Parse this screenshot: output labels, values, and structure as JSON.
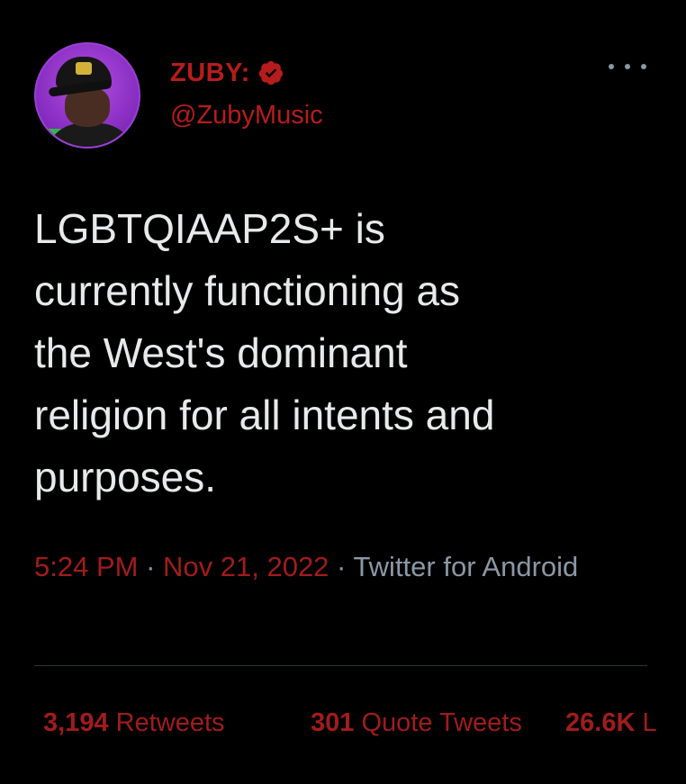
{
  "author": {
    "display_name": "ZUBY:",
    "handle": "@ZubyMusic",
    "verified": true
  },
  "tweet": {
    "text": "LGBTQIAAP2S+ is\ncurrently functioning as\nthe West's dominant\nreligion for all intents and\npurposes."
  },
  "meta": {
    "time": "5:24 PM",
    "separator": " · ",
    "date": "Nov 21, 2022",
    "source": "Twitter for Android"
  },
  "stats": {
    "retweets_count": "3,194",
    "retweets_label": "Retweets",
    "quotes_count": "301",
    "quotes_label": "Quote Tweets",
    "likes_count": "26.6K",
    "likes_label": "L"
  },
  "colors": {
    "background": "#000000",
    "accent_red": "#b71c1c",
    "text": "#e7e9ea",
    "muted": "#8b98a5",
    "avatar_ring": "#9b3fd6"
  },
  "icons": {
    "verified": "verified-badge-icon",
    "more": "more-options-icon"
  }
}
